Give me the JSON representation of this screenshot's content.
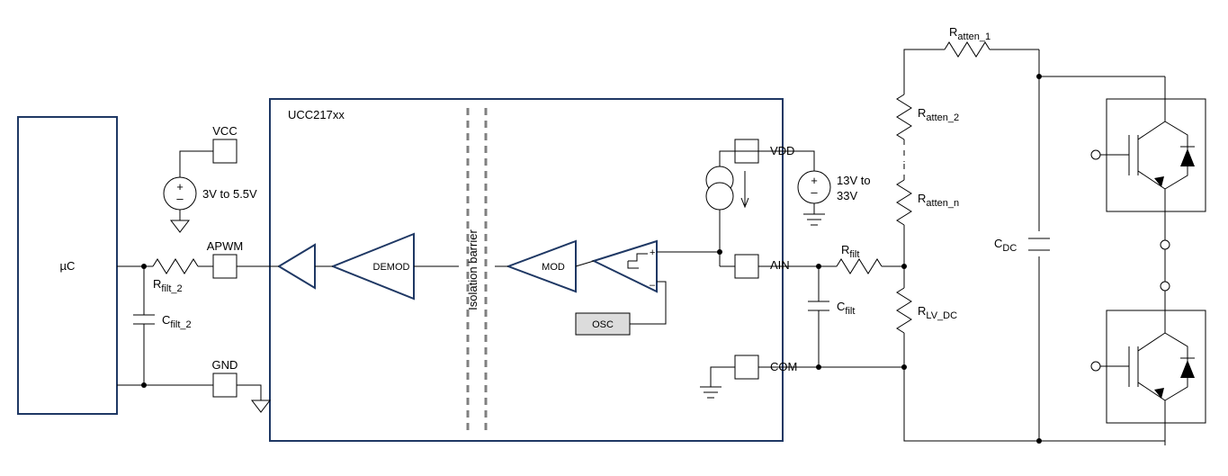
{
  "blocks": {
    "uC": "µC",
    "chip": "UCC217xx",
    "vcc": "VCC",
    "gnd": "GND",
    "apwm": "APWM",
    "demod": "DEMOD",
    "barrier": "Isolation barrier",
    "mod": "MOD",
    "osc": "OSC",
    "vdd": "VDD",
    "ain": "AIN",
    "com": "COM"
  },
  "components": {
    "vcc_src": "3V to 5.5V",
    "vdd_src_line1": "13V to",
    "vdd_src_line2": "33V",
    "R_filt_2": "R",
    "R_filt_2_sub": "filt_2",
    "C_filt_2": "C",
    "C_filt_2_sub": "filt_2",
    "R_filt": "R",
    "R_filt_sub": "filt",
    "C_filt": "C",
    "C_filt_sub": "filt",
    "R_atten_1": "R",
    "R_atten_1_sub": "atten_1",
    "R_atten_2": "R",
    "R_atten_2_sub": "atten_2",
    "R_atten_n": "R",
    "R_atten_n_sub": "atten_n",
    "R_lv_dc": "R",
    "R_lv_dc_sub": "LV_DC",
    "C_dc": "C",
    "C_dc_sub": "DC"
  }
}
